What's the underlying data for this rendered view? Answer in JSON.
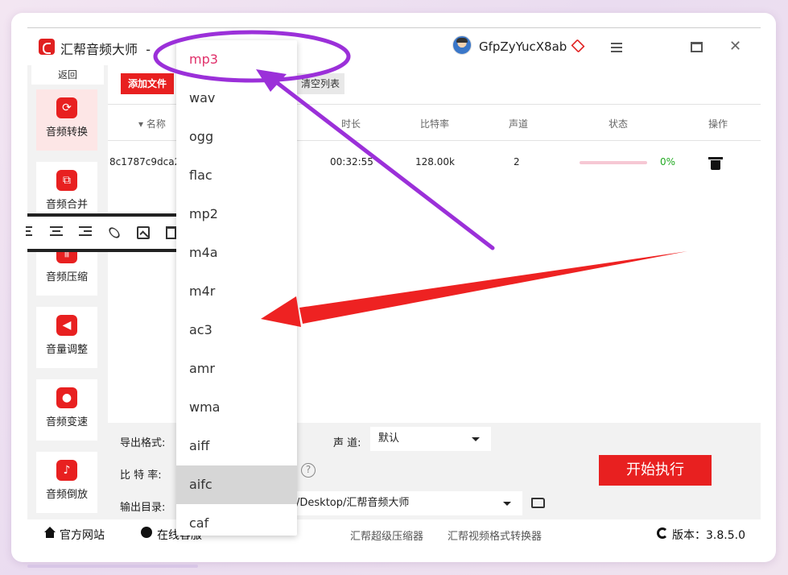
{
  "titlebar": {
    "app_name": "汇帮音频大师",
    "title_rest": "-",
    "username": "GfpZyYucX8ab",
    "icons": [
      "app-logo",
      "user-avatar",
      "vip-diamond-icon",
      "hamburger-menu-icon",
      "maximize-icon",
      "close-icon"
    ]
  },
  "sidebar": {
    "back_label": "返回",
    "items": [
      {
        "label": "音频转换",
        "icon": "audio-convert-icon"
      },
      {
        "label": "音频合并",
        "icon": "audio-merge-icon"
      },
      {
        "label": "音频压缩",
        "icon": "audio-compress-icon"
      },
      {
        "label": "音量调整",
        "icon": "volume-adjust-icon"
      },
      {
        "label": "音频变速",
        "icon": "audio-speed-icon"
      },
      {
        "label": "音频倒放",
        "icon": "audio-reverse-icon"
      }
    ]
  },
  "toolbar": {
    "add_file": "添加文件",
    "clear_list": "清空列表"
  },
  "table": {
    "headers": {
      "name": "名称",
      "duration": "时长",
      "bitrate": "比特率",
      "channels": "声道",
      "status": "状态",
      "action": "操作"
    },
    "rows": [
      {
        "name": "8c1787c9dca2",
        "duration": "00:32:55",
        "bitrate": "128.00k",
        "channels": "2",
        "progress": 0,
        "progress_label": "0%"
      }
    ]
  },
  "settings": {
    "format_label": "导出格式:",
    "channel_label": "声 道:",
    "channel_value": "默认",
    "bitrate_label": "比 特 率:",
    "output_label": "输出目录:",
    "output_value": "/Desktop/汇帮音频大师",
    "help_symbol": "?",
    "start_button": "开始执行"
  },
  "format_dropdown": {
    "options": [
      "mp3",
      "wav",
      "ogg",
      "flac",
      "mp2",
      "m4a",
      "m4r",
      "ac3",
      "amr",
      "wma",
      "aiff",
      "aifc",
      "caf"
    ],
    "selected": "mp3",
    "hovered": "aifc"
  },
  "footer": {
    "website": "官方网站",
    "support": "在线客服",
    "compressor": "汇帮超级压缩器",
    "video_converter": "汇帮视频格式转换器",
    "version": "版本：3.8.5.0"
  },
  "colors": {
    "accent": "#e82020",
    "selected_option": "#e0306a",
    "progress_ok": "#22aa22",
    "annotation_purple": "#9b30d9",
    "annotation_red": "#ee2222"
  }
}
